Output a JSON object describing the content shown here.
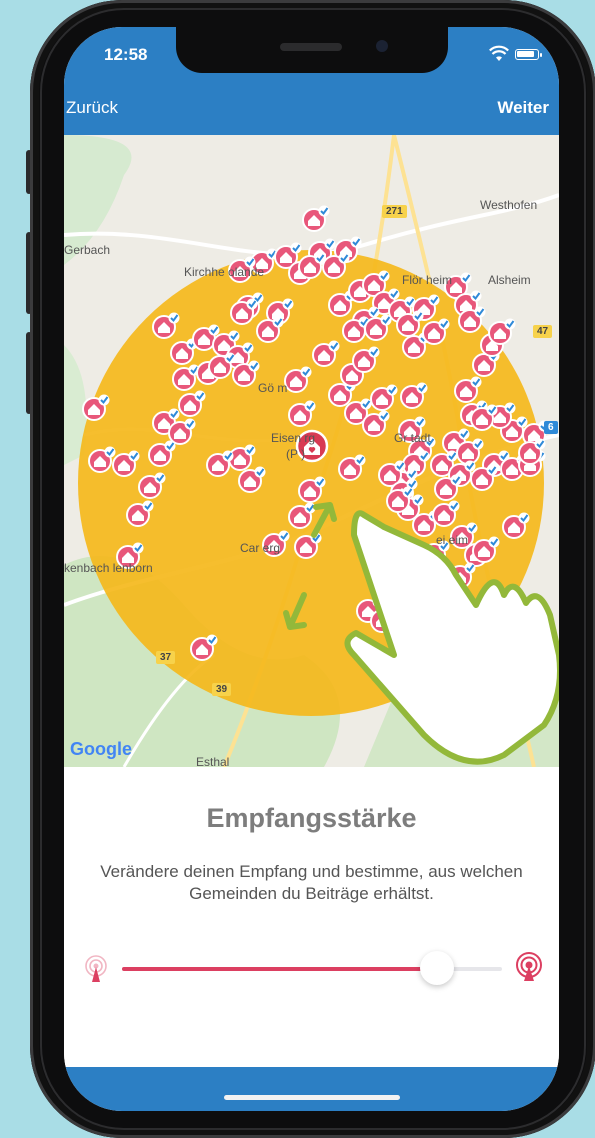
{
  "status_bar": {
    "time": "12:58"
  },
  "nav": {
    "back_label": "Zurück",
    "next_label": "Weiter"
  },
  "map": {
    "places": {
      "westhofen": "Westhofen",
      "gerbach": "Gerbach",
      "kirchheimbolanden": "Kirchhe   olande",
      "floersheim": "Flör  heim",
      "alsheim": "Alsheim",
      "goellheim": "Gö   m",
      "eisenberg": "Eisen  rg",
      "pfalz": "(P   )",
      "gruenstadt": "Gr   tadt",
      "carlsberg": "Car   erg",
      "enkenbach": "kenbach   lenborn",
      "esthal": "Esthal",
      "heim": "ei   eim"
    },
    "route_labels": {
      "r271": "271",
      "r47": "47",
      "r6": "6",
      "r37": "37",
      "r39": "39"
    },
    "google_logo": "Google",
    "colors": {
      "radius_circle": "#f5b91c",
      "marker": "#e8577a",
      "check": "#2f8ad8",
      "center_marker": "#d83a53"
    }
  },
  "panel": {
    "title": "Empfangsstärke",
    "description": "Verändere deinen Empfang und bestimme, aus welchen Gemeinden du Beiträge erhältst.",
    "slider_value_fraction": 0.83,
    "colors": {
      "accent": "#dc3f61"
    }
  },
  "icons": {
    "signal_low": "antenna-small-icon",
    "signal_high": "antenna-large-icon",
    "hand": "hand-pointer-icon"
  },
  "theme": {
    "header_blue": "#2c7fc4",
    "background": "#a9dde6"
  }
}
